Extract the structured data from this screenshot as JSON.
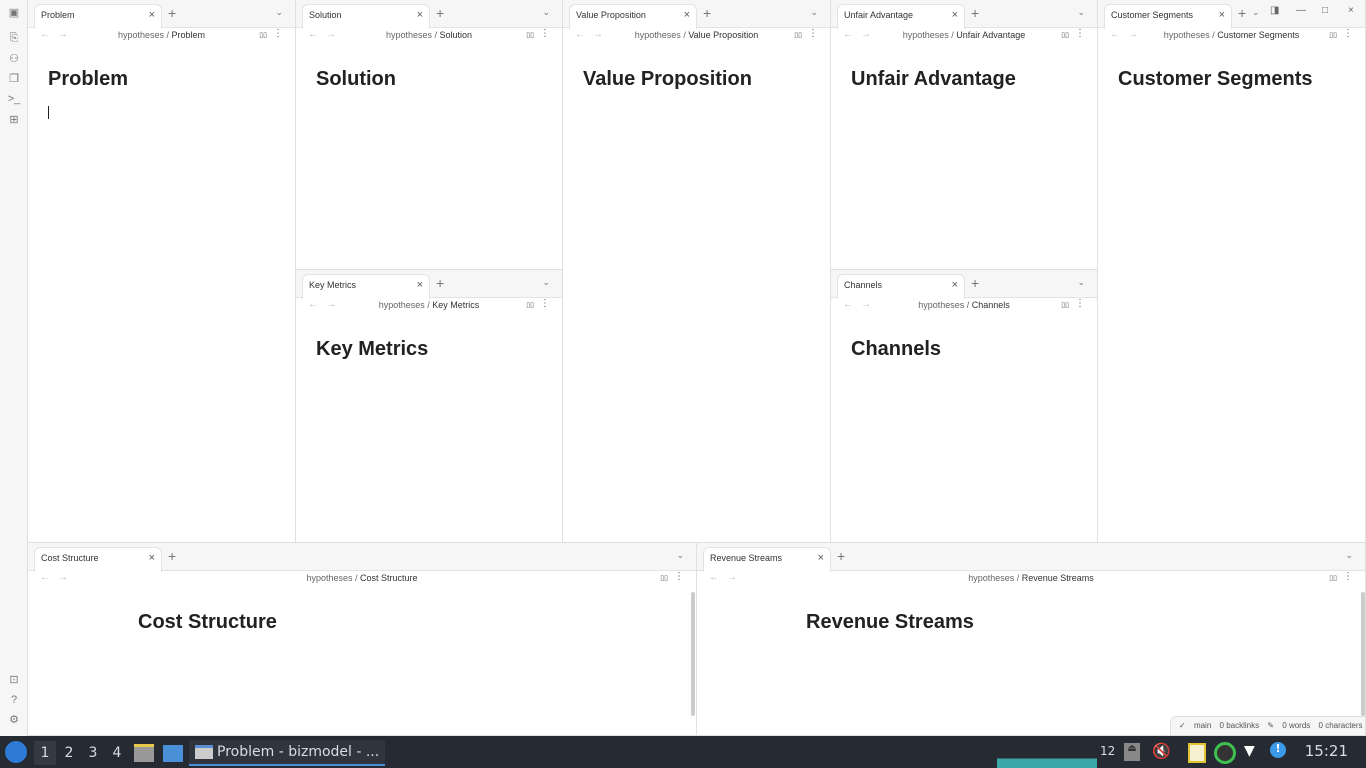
{
  "window_title": "Problem - bizmodel - ...",
  "breadcrumb_root": "hypotheses",
  "panes": [
    {
      "tab": "Problem",
      "title": "Problem",
      "active": true
    },
    {
      "tab": "Solution",
      "title": "Solution"
    },
    {
      "tab": "Key Metrics",
      "title": "Key Metrics"
    },
    {
      "tab": "Value Proposition",
      "title": "Value Proposition"
    },
    {
      "tab": "Unfair Advantage",
      "title": "Unfair Advantage"
    },
    {
      "tab": "Channels",
      "title": "Channels"
    },
    {
      "tab": "Customer Segments",
      "title": "Customer Segments"
    },
    {
      "tab": "Cost Structure",
      "title": "Cost Structure"
    },
    {
      "tab": "Revenue Streams",
      "title": "Revenue Streams"
    }
  ],
  "status": {
    "branch": "main",
    "backlinks": "0 backlinks",
    "words": "0 words",
    "characters": "0 characters"
  },
  "taskbar": {
    "workspaces": [
      "1",
      "2",
      "3",
      "4"
    ],
    "active_workspace": "1",
    "task_label": "Problem - bizmodel - ...",
    "cpu_count": "12",
    "clock": "15:21"
  },
  "icons": {
    "close": "close-icon",
    "new_tab": "plus-icon",
    "menu": "chevron-down-icon",
    "back": "arrow-left-icon",
    "forward": "arrow-right-icon",
    "reading": "book-icon",
    "more": "more-vertical-icon"
  }
}
